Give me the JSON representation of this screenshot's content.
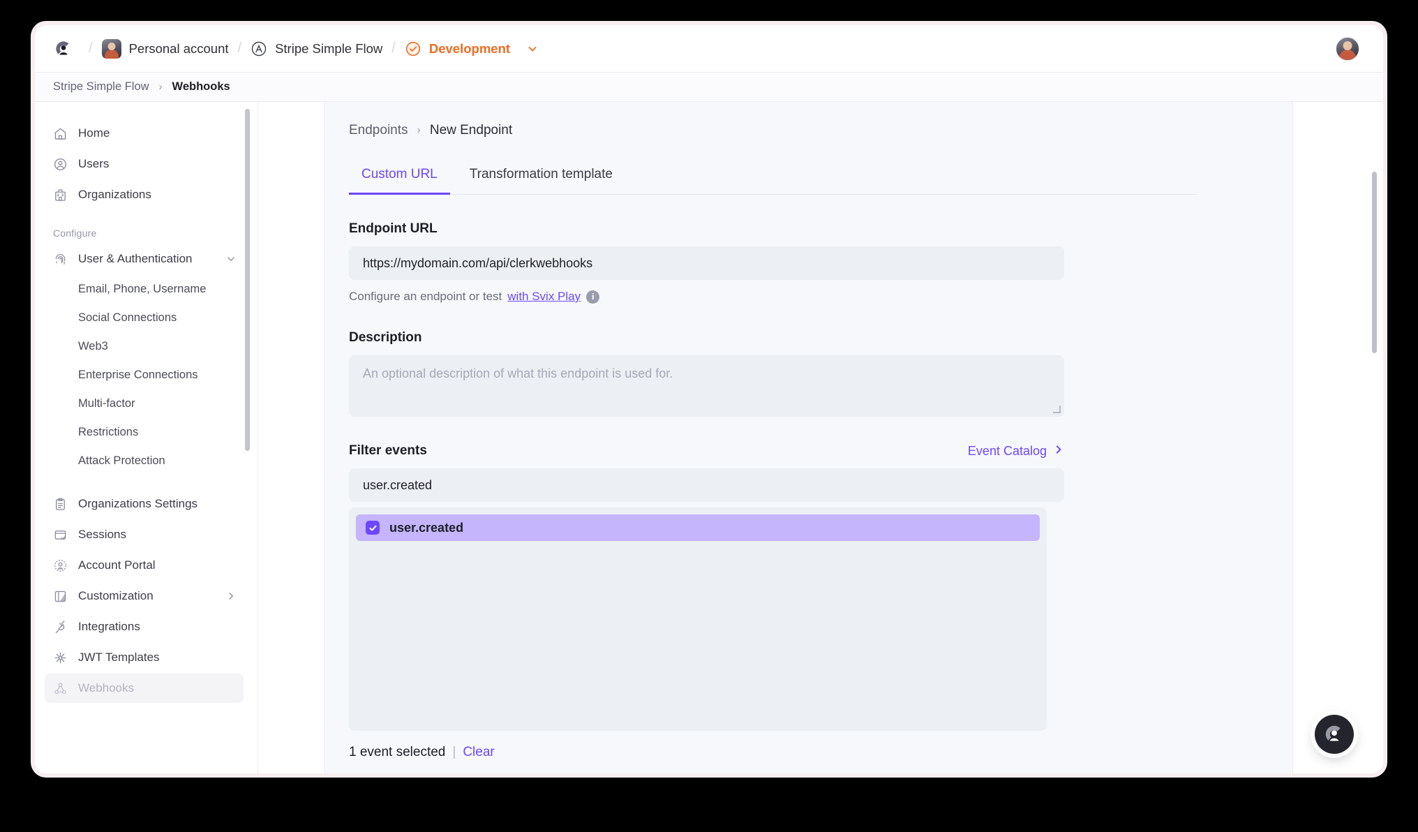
{
  "topbar": {
    "logo_icon": "clerk-logo-icon",
    "account": {
      "label": "Personal account",
      "avatar_icon": "user-avatar-icon"
    },
    "application": {
      "label": "Stripe Simple Flow",
      "icon": "application-icon"
    },
    "environment": {
      "label": "Development",
      "icon": "check-circle-icon",
      "chevron_icon": "chevron-down-icon",
      "color": "#f26b21"
    },
    "separator": "/",
    "profile_avatar_icon": "profile-avatar-icon"
  },
  "breadcrumb": {
    "app": "Stripe Simple Flow",
    "arrow": "›",
    "current": "Webhooks"
  },
  "sidebar": {
    "primary": [
      {
        "label": "Home",
        "icon": "home-icon"
      },
      {
        "label": "Users",
        "icon": "users-icon"
      },
      {
        "label": "Organizations",
        "icon": "organizations-icon"
      }
    ],
    "group_label": "Configure",
    "user_auth": {
      "label": "User & Authentication",
      "icon": "fingerprint-icon",
      "chevron_icon": "chevron-down-icon",
      "children": [
        "Email, Phone, Username",
        "Social Connections",
        "Web3",
        "Enterprise Connections",
        "Multi-factor",
        "Restrictions",
        "Attack Protection"
      ]
    },
    "secondary": [
      {
        "label": "Organizations Settings",
        "icon": "clipboard-icon"
      },
      {
        "label": "Sessions",
        "icon": "session-icon"
      },
      {
        "label": "Account Portal",
        "icon": "account-portal-icon"
      },
      {
        "label": "Customization",
        "icon": "customization-icon",
        "chevron_icon": "chevron-right-icon"
      },
      {
        "label": "Integrations",
        "icon": "plug-icon"
      },
      {
        "label": "JWT Templates",
        "icon": "jwt-icon"
      },
      {
        "label": "Webhooks",
        "icon": "webhooks-icon",
        "active": true
      }
    ]
  },
  "main": {
    "crumb": {
      "parent": "Endpoints",
      "arrow": "›",
      "current": "New Endpoint"
    },
    "tabs": [
      {
        "label": "Custom URL",
        "active": true
      },
      {
        "label": "Transformation template",
        "active": false
      }
    ],
    "endpoint_url": {
      "label": "Endpoint URL",
      "value": "https://mydomain.com/api/clerkwebhooks",
      "helper_prefix": "Configure an endpoint or test",
      "helper_link": "with Svix Play",
      "info_icon": "info-icon",
      "info_glyph": "i"
    },
    "description": {
      "label": "Description",
      "value": "",
      "placeholder": "An optional description of what this endpoint is used for."
    },
    "filter_events": {
      "label": "Filter events",
      "catalog_link": "Event Catalog",
      "catalog_chevron_icon": "chevron-right-icon",
      "search_value": "user.created",
      "options": [
        {
          "label": "user.created",
          "checked": true
        }
      ],
      "selected_text": "1 event selected",
      "divider": "|",
      "clear_label": "Clear"
    }
  },
  "floating": {
    "badge_icon": "clerk-logo-icon"
  },
  "colors": {
    "accent": "#6c47ff",
    "dev_orange": "#f26b21",
    "option_selected_bg": "#c4b5fd",
    "field_bg": "#eceff3"
  }
}
